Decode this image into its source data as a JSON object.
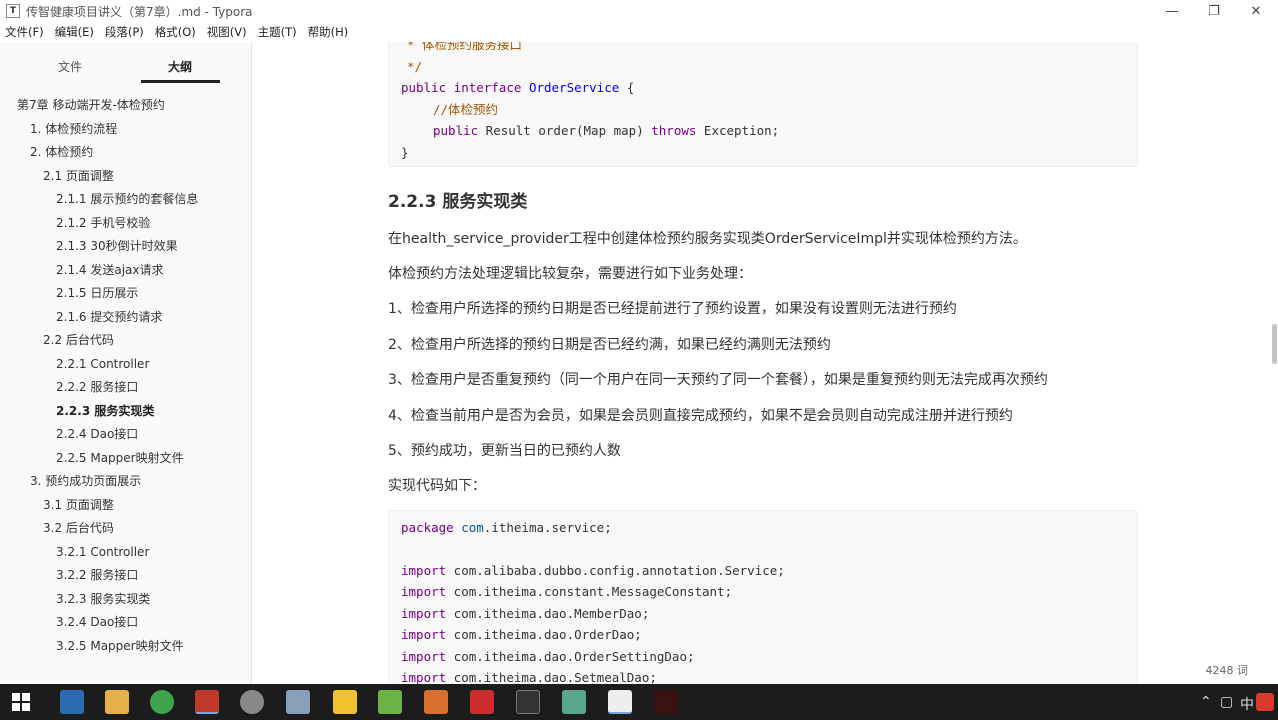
{
  "window": {
    "title": "传智健康项目讲义（第7章）.md - Typora",
    "app_icon": "T"
  },
  "menu": [
    "文件(F)",
    "编辑(E)",
    "段落(P)",
    "格式(O)",
    "视图(V)",
    "主题(T)",
    "帮助(H)"
  ],
  "sidebar": {
    "tabs": [
      "文件",
      "大纲"
    ],
    "active_tab": "大纲",
    "outline": [
      {
        "label": "第7章 移动端开发-体检预约",
        "level": 0
      },
      {
        "label": "1. 体检预约流程",
        "level": 1
      },
      {
        "label": "2. 体检预约",
        "level": 1
      },
      {
        "label": "2.1 页面调整",
        "level": 2
      },
      {
        "label": "2.1.1 展示预约的套餐信息",
        "level": 3
      },
      {
        "label": "2.1.2 手机号校验",
        "level": 3
      },
      {
        "label": "2.1.3 30秒倒计时效果",
        "level": 3
      },
      {
        "label": "2.1.4 发送ajax请求",
        "level": 3
      },
      {
        "label": "2.1.5 日历展示",
        "level": 3
      },
      {
        "label": "2.1.6 提交预约请求",
        "level": 3
      },
      {
        "label": "2.2 后台代码",
        "level": 2
      },
      {
        "label": "2.2.1 Controller",
        "level": 3
      },
      {
        "label": "2.2.2 服务接口",
        "level": 3
      },
      {
        "label": "2.2.3 服务实现类",
        "level": 3,
        "active": true
      },
      {
        "label": "2.2.4 Dao接口",
        "level": 3
      },
      {
        "label": "2.2.5 Mapper映射文件",
        "level": 3
      },
      {
        "label": "3. 预约成功页面展示",
        "level": 1
      },
      {
        "label": "3.1 页面调整",
        "level": 2
      },
      {
        "label": "3.2 后台代码",
        "level": 2
      },
      {
        "label": "3.2.1 Controller",
        "level": 3
      },
      {
        "label": "3.2.2 服务接口",
        "level": 3
      },
      {
        "label": "3.2.3 服务实现类",
        "level": 3
      },
      {
        "label": "3.2.4 Dao接口",
        "level": 3
      },
      {
        "label": "3.2.5 Mapper映射文件",
        "level": 3
      }
    ],
    "footer_back": "<",
    "footer_source": "</>"
  },
  "content": {
    "code1_lines": [
      "* 体检预约服务接口",
      "*/",
      "public interface OrderService {",
      "    //体检预约",
      "    public Result order(Map map) throws Exception;",
      "}"
    ],
    "heading": "2.2.3 服务实现类",
    "paragraphs": [
      "在health_service_provider工程中创建体检预约服务实现类OrderServiceImpl并实现体检预约方法。",
      "体检预约方法处理逻辑比较复杂，需要进行如下业务处理：",
      "1、检查用户所选择的预约日期是否已经提前进行了预约设置，如果没有设置则无法进行预约",
      "2、检查用户所选择的预约日期是否已经约满，如果已经约满则无法预约",
      "3、检查用户是否重复预约（同一个用户在同一天预约了同一个套餐），如果是重复预约则无法完成再次预约",
      "4、检查当前用户是否为会员，如果是会员则直接完成预约，如果不是会员则自动完成注册并进行预约",
      "5、预约成功，更新当日的已预约人数",
      "实现代码如下："
    ],
    "code2_lines": [
      "package com.itheima.service;",
      "",
      "import com.alibaba.dubbo.config.annotation.Service;",
      "import com.itheima.constant.MessageConstant;",
      "import com.itheima.dao.MemberDao;",
      "import com.itheima.dao.OrderDao;",
      "import com.itheima.dao.OrderSettingDao;",
      "import com.itheima.dao.SetmealDao;"
    ]
  },
  "status": {
    "word_count": "4248 词"
  },
  "colors": {
    "keyword": "#770088",
    "definition": "#0000ff",
    "comment": "#aa5500",
    "taskbar": "#1c1c1c"
  }
}
